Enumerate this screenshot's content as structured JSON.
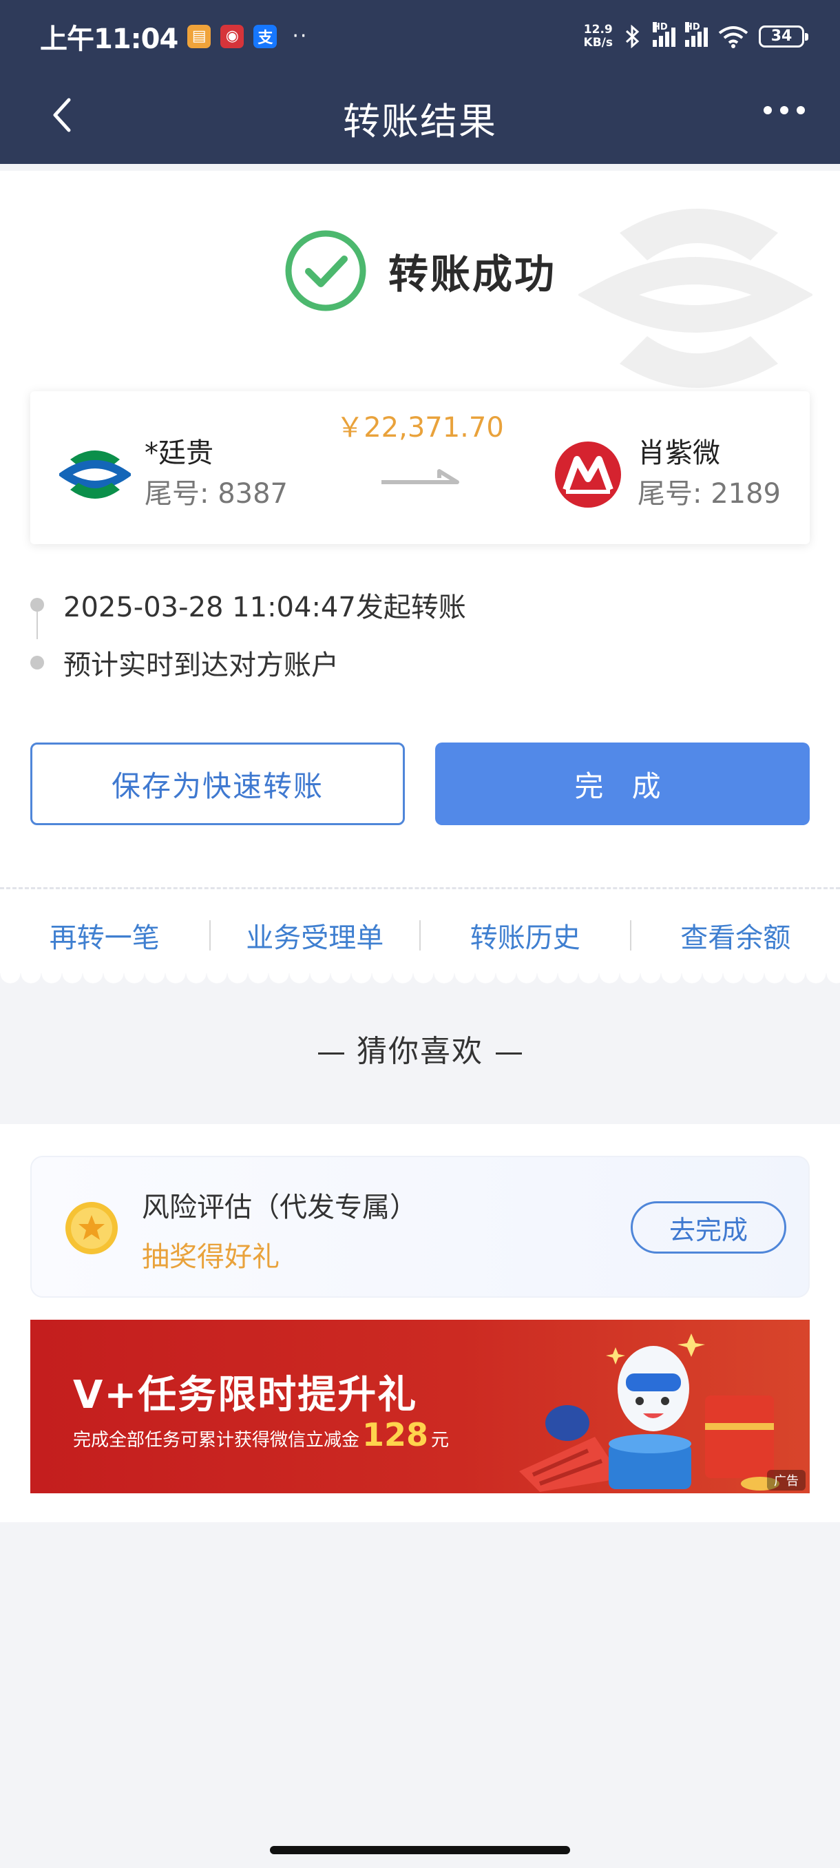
{
  "status_bar": {
    "time": "上午11:04",
    "net_speed_value": "12.9",
    "net_speed_unit": "KB/s",
    "signal_label": "HD",
    "battery": "34",
    "more": "··"
  },
  "header": {
    "title": "转账结果"
  },
  "result": {
    "status_text": "转账成功",
    "amount": "￥22,371.70",
    "from": {
      "name": "*廷贵",
      "tail": "尾号: 8387"
    },
    "to": {
      "name": "肖紫微",
      "tail": "尾号: 2189"
    }
  },
  "timeline": [
    {
      "text": "2025-03-28 11:04:47发起转账"
    },
    {
      "text": "预计实时到达对方账户"
    }
  ],
  "buttons": {
    "save_quick": "保存为快速转账",
    "done": "完 成"
  },
  "quick_links": [
    "再转一笔",
    "业务受理单",
    "转账历史",
    "查看余额"
  ],
  "recommend": {
    "heading": "猜你喜欢",
    "task": {
      "title": "风险评估（代发专属）",
      "subtitle": "抽奖得好礼",
      "action": "去完成"
    },
    "banner": {
      "title": "V+任务限时提升礼",
      "sub_prefix": "完成全部任务可累计获得微信立减金",
      "sub_number": "128",
      "sub_suffix": "元",
      "ad_tag": "广告"
    }
  },
  "colors": {
    "header_bg": "#2f3b5a",
    "accent_blue": "#5289e8",
    "amount_orange": "#e9a23b",
    "success_green": "#4cb86e",
    "banner_red": "#c41e1e"
  }
}
